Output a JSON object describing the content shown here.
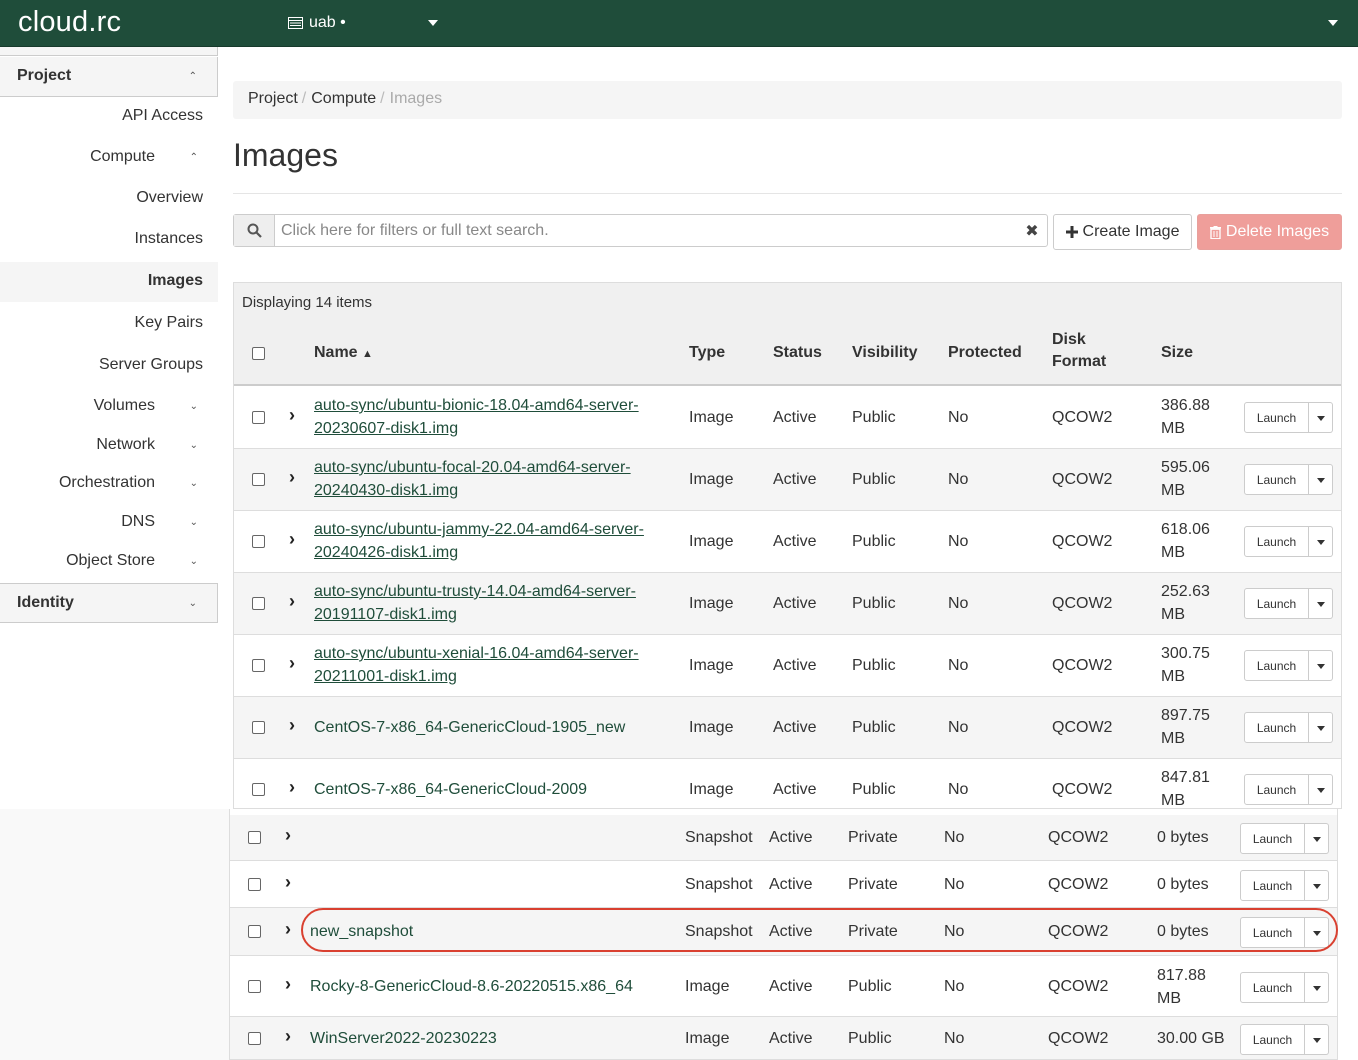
{
  "topbar": {
    "brand": "cloud.rc",
    "project": "uab •"
  },
  "sidebar": {
    "project": "Project",
    "items": [
      "API Access",
      "Compute",
      "Overview",
      "Instances",
      "Images",
      "Key Pairs",
      "Server Groups",
      "Volumes",
      "Network",
      "Orchestration",
      "DNS",
      "Object Store"
    ],
    "identity": "Identity"
  },
  "breadcrumb": {
    "a": "Project",
    "b": "Compute",
    "c": "Images"
  },
  "title": "Images",
  "search": {
    "placeholder": "Click here for filters or full text search."
  },
  "buttons": {
    "create": "Create Image",
    "delete": "Delete Images",
    "launch": "Launch"
  },
  "table": {
    "displaying": "Displaying 14 items",
    "headers": {
      "name": "Name",
      "type": "Type",
      "status": "Status",
      "visibility": "Visibility",
      "protected": "Protected",
      "disk1": "Disk",
      "disk2": "Format",
      "size": "Size"
    },
    "rows": [
      {
        "name1": "auto-sync/ubuntu-bionic-18.04-amd64-server-",
        "name2": "20230607-disk1.img",
        "type": "Image",
        "status": "Active",
        "visibility": "Public",
        "protected": "No",
        "format": "QCOW2",
        "size1": "386.88",
        "size2": "MB"
      },
      {
        "name1": "auto-sync/ubuntu-focal-20.04-amd64-server-",
        "name2": "20240430-disk1.img",
        "type": "Image",
        "status": "Active",
        "visibility": "Public",
        "protected": "No",
        "format": "QCOW2",
        "size1": "595.06",
        "size2": "MB"
      },
      {
        "name1": "auto-sync/ubuntu-jammy-22.04-amd64-server-",
        "name2": "20240426-disk1.img",
        "type": "Image",
        "status": "Active",
        "visibility": "Public",
        "protected": "No",
        "format": "QCOW2",
        "size1": "618.06",
        "size2": "MB"
      },
      {
        "name1": "auto-sync/ubuntu-trusty-14.04-amd64-server-",
        "name2": "20191107-disk1.img",
        "type": "Image",
        "status": "Active",
        "visibility": "Public",
        "protected": "No",
        "format": "QCOW2",
        "size1": "252.63",
        "size2": "MB"
      },
      {
        "name1": "auto-sync/ubuntu-xenial-16.04-amd64-server-",
        "name2": "20211001-disk1.img",
        "type": "Image",
        "status": "Active",
        "visibility": "Public",
        "protected": "No",
        "format": "QCOW2",
        "size1": "300.75",
        "size2": "MB"
      },
      {
        "name1": "CentOS-7-x86_64-GenericCloud-1905_new",
        "name2": "",
        "type": "Image",
        "status": "Active",
        "visibility": "Public",
        "protected": "No",
        "format": "QCOW2",
        "size1": "897.75",
        "size2": "MB"
      },
      {
        "name1": "CentOS-7-x86_64-GenericCloud-2009",
        "name2": "",
        "type": "Image",
        "status": "Active",
        "visibility": "Public",
        "protected": "No",
        "format": "QCOW2",
        "size1": "847.81",
        "size2": "MB"
      }
    ],
    "lower_rows": [
      {
        "name": "",
        "type": "Snapshot",
        "status": "Active",
        "visibility": "Private",
        "protected": "No",
        "format": "QCOW2",
        "size1": "0 bytes",
        "size2": ""
      },
      {
        "name": "",
        "type": "Snapshot",
        "status": "Active",
        "visibility": "Private",
        "protected": "No",
        "format": "QCOW2",
        "size1": "0 bytes",
        "size2": ""
      },
      {
        "name": "new_snapshot",
        "type": "Snapshot",
        "status": "Active",
        "visibility": "Private",
        "protected": "No",
        "format": "QCOW2",
        "size1": "0 bytes",
        "size2": ""
      },
      {
        "name": "Rocky-8-GenericCloud-8.6-20220515.x86_64",
        "type": "Image",
        "status": "Active",
        "visibility": "Public",
        "protected": "No",
        "format": "QCOW2",
        "size1": "817.88",
        "size2": "MB"
      },
      {
        "name": "WinServer2022-20230223",
        "type": "Image",
        "status": "Active",
        "visibility": "Public",
        "protected": "No",
        "format": "QCOW2",
        "size1": "30.00 GB",
        "size2": ""
      }
    ]
  },
  "colors": {
    "topbar": "#1f4d3a",
    "link": "#1f4d3a",
    "danger": "#ef9e9a",
    "highlight": "#d94030"
  }
}
